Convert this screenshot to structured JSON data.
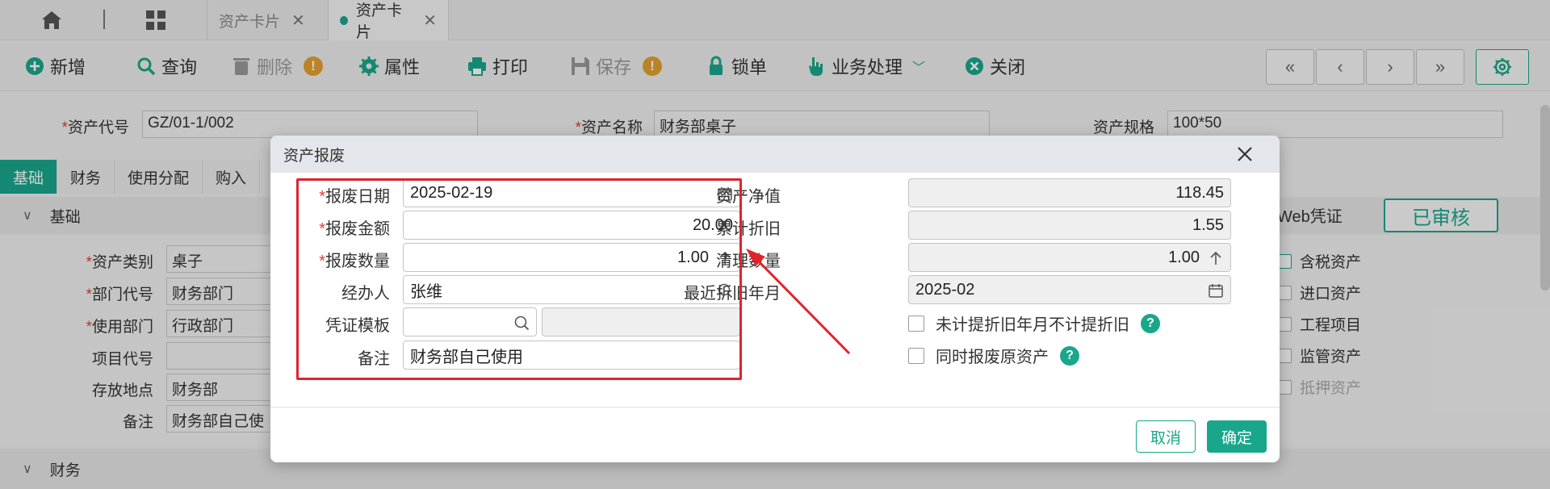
{
  "tabs": [
    {
      "label": "资产卡片",
      "active": false
    },
    {
      "label": "资产卡片",
      "active": true
    }
  ],
  "toolbar": {
    "add": "新增",
    "query": "查询",
    "delete": "删除",
    "properties": "属性",
    "print": "打印",
    "save": "保存",
    "lock": "锁单",
    "business": "业务处理",
    "close": "关闭"
  },
  "header": {
    "asset_code_label": "资产代号",
    "asset_code": "GZ/01-1/002",
    "asset_name_label": "资产名称",
    "asset_name": "财务部桌子",
    "asset_spec_label": "资产规格",
    "asset_spec": "100*50"
  },
  "subtabs": [
    "基础",
    "财务",
    "使用分配",
    "购入"
  ],
  "sections": {
    "basic": "基础",
    "finance": "财务"
  },
  "basic_form": {
    "category_label": "资产类别",
    "category": "桌子",
    "dept_label": "部门代号",
    "dept": "财务部门",
    "use_dept_label": "使用部门",
    "use_dept": "行政部门",
    "project_label": "项目代号",
    "project": "",
    "location_label": "存放地点",
    "location": "财务部",
    "remark_label": "备注",
    "remark": "财务部自己使"
  },
  "right_panel": {
    "web_voucher": "Web凭证",
    "audited": "已审核",
    "checks": [
      {
        "label": "含税资产",
        "checked": true
      },
      {
        "label": "进口资产",
        "checked": false
      },
      {
        "label": "工程项目",
        "checked": false
      },
      {
        "label": "监管资产",
        "checked": false
      },
      {
        "label": "抵押资产",
        "checked": false
      }
    ]
  },
  "dialog": {
    "title": "资产报废",
    "scrap_date_label": "报废日期",
    "scrap_date": "2025-02-19",
    "scrap_amount_label": "报废金额",
    "scrap_amount": "20.00",
    "scrap_qty_label": "报废数量",
    "scrap_qty": "1.00",
    "handler_label": "经办人",
    "handler": "张维",
    "voucher_tpl_label": "凭证模板",
    "voucher_tpl": "",
    "voucher_tpl_name": "",
    "remark_label": "备注",
    "remark": "财务部自己使用",
    "net_value_label": "资产净值",
    "net_value": "118.45",
    "acc_dep_label": "累计折旧",
    "acc_dep": "1.55",
    "clear_qty_label": "清理数量",
    "clear_qty": "1.00",
    "last_dep_label": "最近折旧年月",
    "last_dep": "2025-02",
    "check1": "未计提折旧年月不计提折旧",
    "check2": "同时报废原资产",
    "cancel": "取消",
    "ok": "确定"
  },
  "colors": {
    "accent": "#19a78b",
    "highlight": "#e0242b",
    "warning": "#e3a12f"
  }
}
